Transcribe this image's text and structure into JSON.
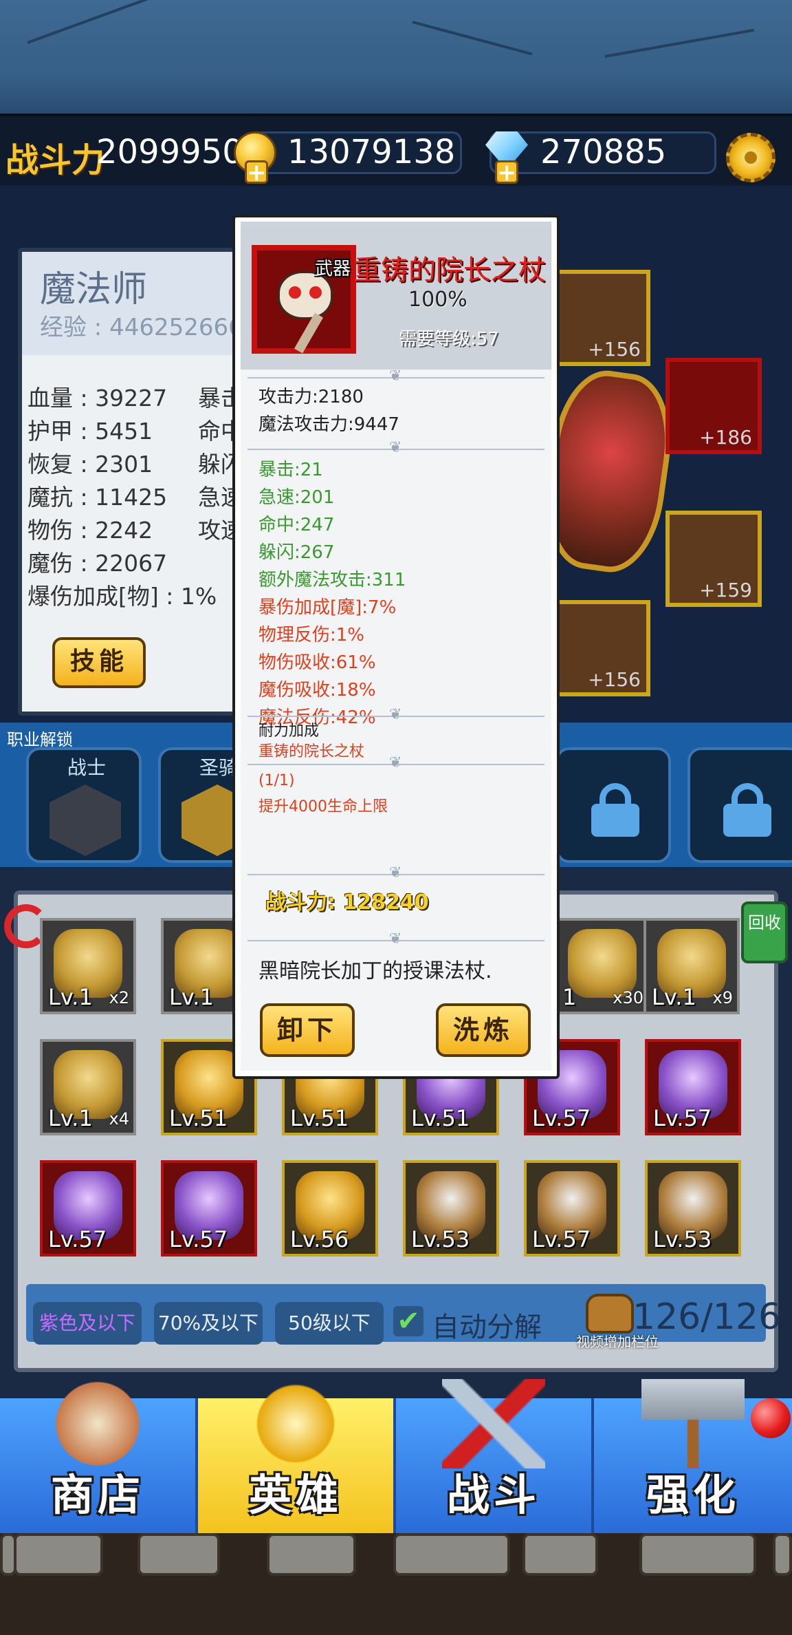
{
  "topbar": {
    "power_label": "战斗力",
    "power_value": "2099950",
    "gold": "13079138",
    "gems": "270885"
  },
  "hero": {
    "class_name": "魔法师",
    "exp": "经验 : 446252666/",
    "stats_left": [
      "血量 : 39227",
      "护甲 : 5451",
      "恢复 : 2301",
      "魔抗 : 11425",
      "物伤 : 2242",
      "魔伤 : 22067",
      "爆伤加成[物] : 1%"
    ],
    "stats_right": [
      "暴击",
      "命中",
      "躲闪",
      "急速",
      "攻速"
    ],
    "skill_button": "技能"
  },
  "equipment": {
    "levels": [
      "+156",
      "+186",
      "+159",
      "+156"
    ]
  },
  "classes": {
    "unlock_label": "职业解锁",
    "items": [
      {
        "name": "战士",
        "locked": false
      },
      {
        "name": "圣骑",
        "locked": false
      },
      {
        "name": "",
        "locked": true
      },
      {
        "name": "",
        "locked": true
      }
    ]
  },
  "inventory": {
    "recycle_label": "回收",
    "rows": [
      [
        {
          "level": "Lv.1",
          "count": "x2",
          "kind": "gray"
        },
        {
          "level": "Lv.1",
          "count": "",
          "kind": "gray"
        },
        {
          "level": "",
          "count": "",
          "kind": "hidden"
        },
        {
          "level": "",
          "count": "",
          "kind": "hidden"
        },
        {
          "level": "1",
          "count": "x30",
          "kind": "gray"
        },
        {
          "level": "Lv.1",
          "count": "x9",
          "kind": "gray"
        }
      ],
      [
        {
          "level": "Lv.1",
          "count": "x4",
          "kind": "gray"
        },
        {
          "level": "Lv.51",
          "count": "",
          "kind": "gold"
        },
        {
          "level": "Lv.51",
          "count": "",
          "kind": "gold"
        },
        {
          "level": "Lv.51",
          "count": "",
          "kind": "gold"
        },
        {
          "level": "Lv.57",
          "count": "",
          "kind": "red"
        },
        {
          "level": "Lv.57",
          "count": "",
          "kind": "red"
        }
      ],
      [
        {
          "level": "Lv.57",
          "count": "",
          "kind": "red"
        },
        {
          "level": "Lv.57",
          "count": "",
          "kind": "red"
        },
        {
          "level": "Lv.56",
          "count": "",
          "kind": "gold"
        },
        {
          "level": "Lv.53",
          "count": "",
          "kind": "gold"
        },
        {
          "level": "Lv.57",
          "count": "",
          "kind": "gold"
        },
        {
          "level": "Lv.53",
          "count": "",
          "kind": "gold"
        }
      ]
    ],
    "filters": [
      "紫色及以下",
      "70%及以下",
      "50级以下"
    ],
    "auto_decompose": "自动分解",
    "capacity": "126/126",
    "capacity_note": "视频增加栏位"
  },
  "nav": {
    "tabs": [
      "商店",
      "英雄",
      "战斗",
      "强化"
    ],
    "active": "英雄"
  },
  "popup": {
    "type_tag": "武器",
    "name": "重铸的院长之杖",
    "quality": "100%",
    "required_level": "需要等级:57",
    "base_stats": [
      "攻击力:2180",
      "魔法攻击力:9447"
    ],
    "green_stats": [
      "暴击:21",
      "急速:201",
      "命中:247",
      "躲闪:267",
      "额外魔法攻击:311"
    ],
    "red_stats": [
      "暴伤加成[魔]:7%",
      "物理反伤:1%",
      "物伤吸收:61%",
      "魔伤吸收:18%",
      "魔法反伤:42%"
    ],
    "set_label": "耐力加成",
    "set_name": "重铸的院长之杖",
    "set_count": "(1/1)",
    "set_bonus": "提升4000生命上限",
    "power": "战斗力: 128240",
    "description": "黑暗院长加丁的授课法杖.",
    "unequip_button": "卸下",
    "refine_button": "洗炼"
  }
}
